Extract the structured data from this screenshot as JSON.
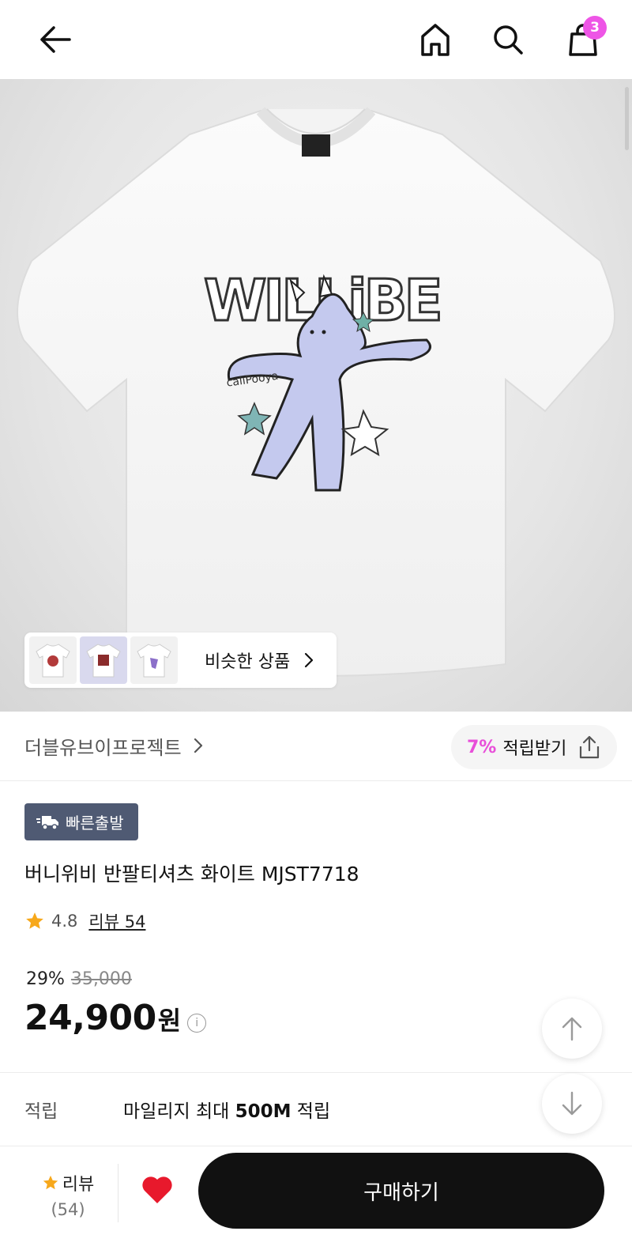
{
  "header": {
    "back_icon": "arrow-left-icon",
    "home_icon": "home-icon",
    "search_icon": "search-icon",
    "cart_icon": "shopping-bag-icon",
    "cart_count": "3"
  },
  "similar": {
    "label": "비슷한 상품"
  },
  "brand": {
    "name": "더블유브이프로젝트",
    "points_percent": "7%",
    "points_label": "적립받기"
  },
  "product": {
    "badge": "빠른출발",
    "title": "버니위비 반팔티셔츠 화이트 MJST7718",
    "rating": "4.8",
    "review_link": "리뷰 54",
    "discount": "29%",
    "original_price": "35,000",
    "price": "24,900",
    "currency": "원"
  },
  "reward": {
    "label": "적립",
    "text_prefix": "마일리지 최대 ",
    "text_bold": "500M",
    "text_suffix": " 적립"
  },
  "bottom": {
    "review_label": "리뷰",
    "review_count": "(54)",
    "buy_label": "구매하기"
  },
  "colors": {
    "accent": "#ee55e6",
    "badge_bg": "#4f5a73",
    "heart": "#e8192c",
    "star": "#f7a81b",
    "buy_bg": "#111111"
  }
}
